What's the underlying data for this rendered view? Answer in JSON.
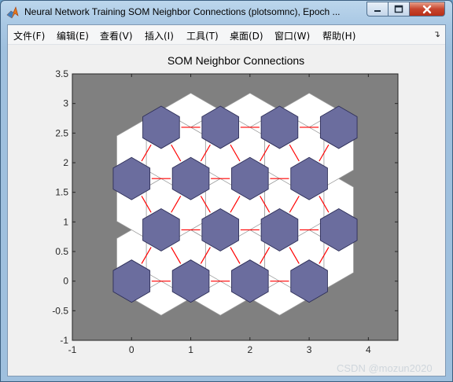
{
  "window": {
    "title": "Neural Network Training SOM Neighbor Connections (plotsomnc), Epoch ...",
    "app_icon": "matlab-icon",
    "controls": [
      "minimize-icon",
      "maximize-icon",
      "close-icon"
    ]
  },
  "menubar": {
    "items": [
      {
        "label": "文件(F)",
        "name": "menu-file"
      },
      {
        "label": "编辑(E)",
        "name": "menu-edit"
      },
      {
        "label": "查看(V)",
        "name": "menu-view"
      },
      {
        "label": "插入(I)",
        "name": "menu-insert"
      },
      {
        "label": "工具(T)",
        "name": "menu-tools"
      },
      {
        "label": "桌面(D)",
        "name": "menu-desktop"
      },
      {
        "label": "窗口(W)",
        "name": "menu-window"
      },
      {
        "label": "帮助(H)",
        "name": "menu-help"
      }
    ],
    "dock_icon": "dock-arrow-icon"
  },
  "chart_data": {
    "type": "scatter",
    "title": "SOM Neighbor Connections",
    "xlabel": "",
    "ylabel": "",
    "xlim": [
      -1,
      4.5
    ],
    "ylim": [
      -1,
      3.5
    ],
    "xticks": [
      "-1",
      "0",
      "1",
      "2",
      "3",
      "4"
    ],
    "yticks": [
      "-1",
      "-0.5",
      "0",
      "0.5",
      "1",
      "1.5",
      "2",
      "2.5",
      "3",
      "3.5"
    ],
    "grid": false,
    "legend": "none",
    "background_color": "#808080",
    "neuron_color": "#6b6d9e",
    "neighbor_patch_color": "#ffffff",
    "connection_color": "#ff0000",
    "neurons": [
      {
        "x": 0,
        "y": 0
      },
      {
        "x": 1,
        "y": 0
      },
      {
        "x": 2,
        "y": 0
      },
      {
        "x": 3,
        "y": 0
      },
      {
        "x": 0.5,
        "y": 0.866
      },
      {
        "x": 1.5,
        "y": 0.866
      },
      {
        "x": 2.5,
        "y": 0.866
      },
      {
        "x": 3.5,
        "y": 0.866
      },
      {
        "x": 0,
        "y": 1.732
      },
      {
        "x": 1,
        "y": 1.732
      },
      {
        "x": 2,
        "y": 1.732
      },
      {
        "x": 3,
        "y": 1.732
      },
      {
        "x": 0.5,
        "y": 2.598
      },
      {
        "x": 1.5,
        "y": 2.598
      },
      {
        "x": 2.5,
        "y": 2.598
      },
      {
        "x": 3.5,
        "y": 2.598
      }
    ],
    "connections": [
      {
        "x": 0.5,
        "y": 0,
        "dir": "horizontal"
      },
      {
        "x": 1.5,
        "y": 0,
        "dir": "horizontal"
      },
      {
        "x": 2.5,
        "y": 0,
        "dir": "horizontal"
      },
      {
        "x": 1,
        "y": 0.866,
        "dir": "horizontal"
      },
      {
        "x": 2,
        "y": 0.866,
        "dir": "horizontal"
      },
      {
        "x": 3,
        "y": 0.866,
        "dir": "horizontal"
      },
      {
        "x": 0.5,
        "y": 1.732,
        "dir": "horizontal"
      },
      {
        "x": 1.5,
        "y": 1.732,
        "dir": "horizontal"
      },
      {
        "x": 2.5,
        "y": 1.732,
        "dir": "horizontal"
      },
      {
        "x": 1,
        "y": 2.598,
        "dir": "horizontal"
      },
      {
        "x": 2,
        "y": 2.598,
        "dir": "horizontal"
      },
      {
        "x": 3,
        "y": 2.598,
        "dir": "horizontal"
      },
      {
        "x": 0.25,
        "y": 0.433,
        "dir": "rising"
      },
      {
        "x": 1.25,
        "y": 0.433,
        "dir": "rising"
      },
      {
        "x": 2.25,
        "y": 0.433,
        "dir": "rising"
      },
      {
        "x": 3.25,
        "y": 0.433,
        "dir": "rising"
      },
      {
        "x": 0.75,
        "y": 0.433,
        "dir": "falling"
      },
      {
        "x": 1.75,
        "y": 0.433,
        "dir": "falling"
      },
      {
        "x": 2.75,
        "y": 0.433,
        "dir": "falling"
      },
      {
        "x": 0.25,
        "y": 1.299,
        "dir": "falling"
      },
      {
        "x": 1.25,
        "y": 1.299,
        "dir": "falling"
      },
      {
        "x": 2.25,
        "y": 1.299,
        "dir": "falling"
      },
      {
        "x": 3.25,
        "y": 1.299,
        "dir": "falling"
      },
      {
        "x": 0.75,
        "y": 1.299,
        "dir": "rising"
      },
      {
        "x": 1.75,
        "y": 1.299,
        "dir": "rising"
      },
      {
        "x": 2.75,
        "y": 1.299,
        "dir": "rising"
      },
      {
        "x": 0.25,
        "y": 2.165,
        "dir": "rising"
      },
      {
        "x": 1.25,
        "y": 2.165,
        "dir": "rising"
      },
      {
        "x": 2.25,
        "y": 2.165,
        "dir": "rising"
      },
      {
        "x": 3.25,
        "y": 2.165,
        "dir": "rising"
      },
      {
        "x": 0.75,
        "y": 2.165,
        "dir": "falling"
      },
      {
        "x": 1.75,
        "y": 2.165,
        "dir": "falling"
      },
      {
        "x": 2.75,
        "y": 2.165,
        "dir": "falling"
      }
    ]
  },
  "watermark": "CSDN @mozun2020"
}
